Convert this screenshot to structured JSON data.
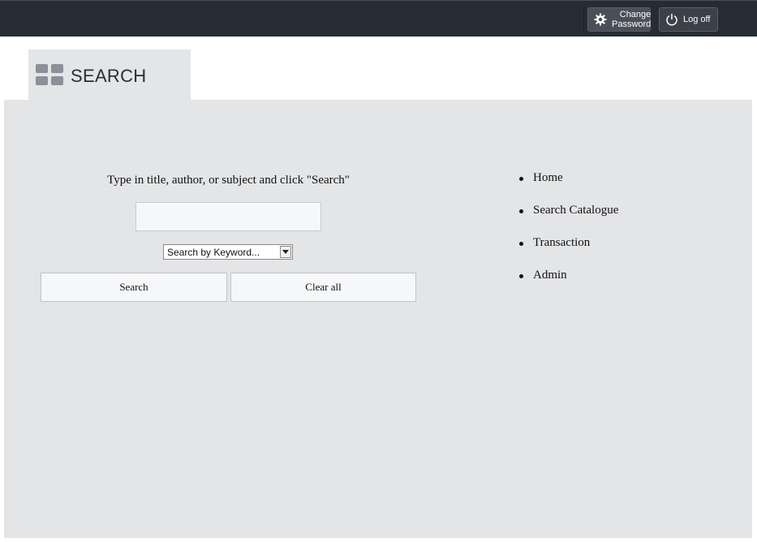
{
  "topbar": {
    "change_password": {
      "line1": "Change",
      "line2": "Password",
      "icon": "gear-icon"
    },
    "log_off": {
      "label": "Log off",
      "icon": "power-icon"
    }
  },
  "tab": {
    "title": "SEARCH",
    "icon": "grid-icon"
  },
  "search": {
    "instruction": "Type in title, author, or subject and click \"Search\"",
    "input_value": "",
    "select_value": "Search by Keyword...",
    "search_button": "Search",
    "clear_button": "Clear all"
  },
  "nav": {
    "items": [
      {
        "label": "Home"
      },
      {
        "label": "Search Catalogue"
      },
      {
        "label": "Transaction"
      },
      {
        "label": "Admin"
      }
    ]
  },
  "colors": {
    "topbar": "#272b33",
    "panel": "#e4e5e7",
    "button": "#f6f7f8"
  }
}
